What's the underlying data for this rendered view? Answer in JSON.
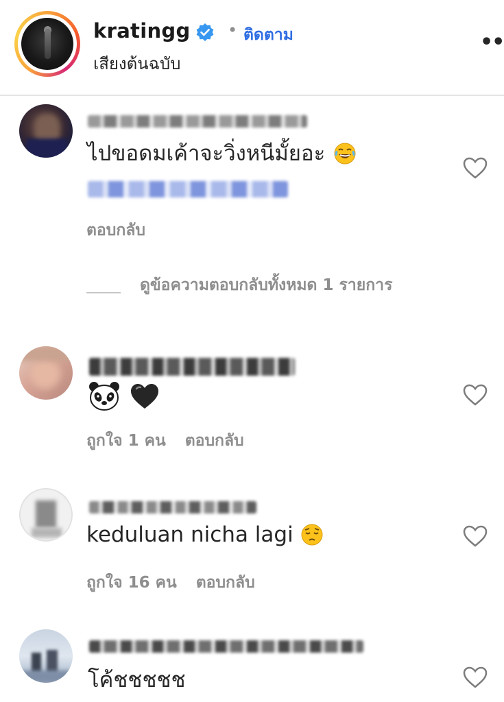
{
  "header": {
    "username": "kratingg",
    "separator": "•",
    "follow_label": "ติดตาม",
    "audio_label": "เสียงต้นฉบับ",
    "more_label": "••"
  },
  "comments": [
    {
      "text": "ไปขอดมเค้าจะวิ่งหนีมั้ยอะ",
      "emoji": "face-with-tears-of-joy",
      "mention_visible": true,
      "likes_label": "",
      "reply_label": "ตอบกลับ",
      "view_replies_label": "ดูข้อความตอบกลับทั้งหมด 1 รายการ"
    },
    {
      "text": "",
      "emoji": "panda-and-black-heart",
      "likes_label": "ถูกใจ 1 คน",
      "reply_label": "ตอบกลับ"
    },
    {
      "text": "keduluan nicha lagi",
      "emoji": "pensive-face",
      "likes_label": "ถูกใจ 16 คน",
      "reply_label": "ตอบกลับ"
    },
    {
      "text": "โค้ชชชชช",
      "emoji": "",
      "likes_label": "",
      "reply_label": ""
    }
  ],
  "colors": {
    "follow_blue": "#2f6de2",
    "verified_blue": "#3897f0",
    "muted_gray": "#8e8e8e",
    "divider": "#e4e4e4"
  },
  "icons": [
    "verified-badge-icon",
    "heart-outline-icon",
    "more-icon"
  ]
}
